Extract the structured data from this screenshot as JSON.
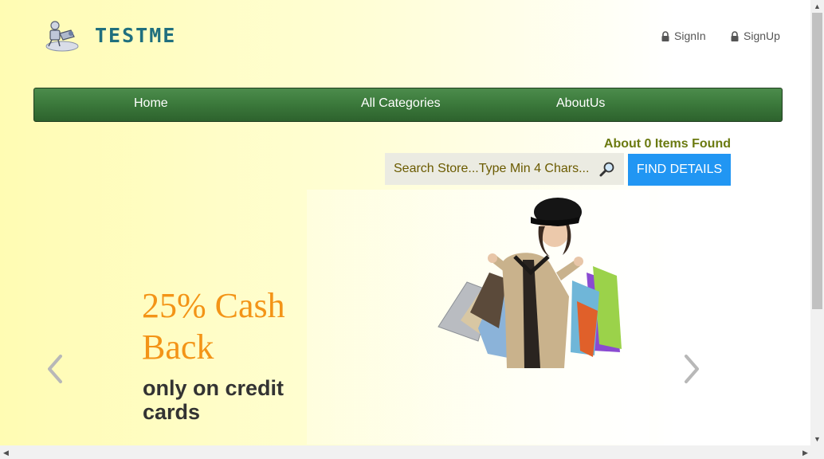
{
  "header": {
    "logo_text": "TESTME",
    "signin_label": "SignIn",
    "signup_label": "SignUp"
  },
  "nav": {
    "items": [
      {
        "label": "Home"
      },
      {
        "label": "All Categories"
      },
      {
        "label": "AboutUs"
      }
    ]
  },
  "search": {
    "results_text": "About 0 Items Found",
    "placeholder": "Search Store...Type Min 4 Chars...",
    "button_label": "FIND DETAILS"
  },
  "banner": {
    "headline": "25% Cash Back",
    "subline": "only on credit cards"
  },
  "colors": {
    "navbar": "#3c7a3c",
    "button": "#2196f3",
    "headline": "#f39417",
    "results_text": "#6b7a10"
  },
  "icons": {
    "lock": "lock-icon",
    "search": "magnifier-icon",
    "prev": "chevron-left-icon",
    "next": "chevron-right-icon"
  }
}
